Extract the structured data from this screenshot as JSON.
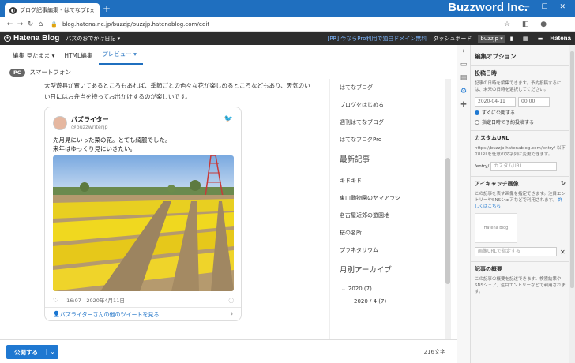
{
  "browser": {
    "tab_title": "ブログ記事編集 - はてなブログ",
    "tab_close": "×",
    "new_tab": "+",
    "brand": "Buzzword Inc.",
    "window_controls": "— ☐ ✕",
    "url": "blog.hatena.ne.jp/buzzjp/buzzjp.hatenablog.com/edit"
  },
  "header": {
    "logo": "Hatena Blog",
    "blog_name": "バズのおでかけ日記",
    "pro_promo": "[PR] 今ならPro利用で独自ドメイン無料",
    "dashboard": "ダッシュボード",
    "user": "buzzjp",
    "hatena": "Hatena"
  },
  "editor": {
    "tabs": [
      {
        "label": "編集"
      },
      {
        "label": "見たまま"
      },
      {
        "label": "HTML編集"
      },
      {
        "label": "プレビュー"
      }
    ],
    "mode_badge": "PC",
    "mode_label": "スマートフォン"
  },
  "preview": {
    "intro_text": "大型遊具が置いてあるところもあれば、季節ごとの色々な花が楽しめるところなどもあり、天気のいい日にはお弁当を持ってお出かけするのが楽しいです。",
    "tweet": {
      "name": "バズライター",
      "handle": "@buzzwriterjp",
      "line1": "先月見にいった菜の花。とても綺麗でした。",
      "line2": "来年はゆっくり見にいきたい。",
      "timestamp": "16:07 - 2020年4月11日",
      "more_link": "バズライターさんの他のツイートを見る"
    },
    "sidebar": {
      "links": [
        "はてなブログ",
        "ブログをはじめる",
        "週刊はてなブログ",
        "はてなブログPro"
      ],
      "recent_title": "最新記事",
      "recent": [
        "キドキド",
        "東山動物園のヤマアラシ",
        "名古屋近郊の遊園地",
        "桜の名所",
        "プラネタリウム"
      ],
      "archive_title": "月別アーカイブ",
      "archive": [
        "2020 (7)",
        "2020 / 4 (7)"
      ]
    }
  },
  "bottom": {
    "publish": "公開する",
    "char_count": "216文字"
  },
  "options": {
    "title": "編集オプション",
    "post_date": {
      "heading": "投稿日時",
      "desc": "記事の日時を編集できます。予約投稿するには、未来の日時を選択してください。",
      "date": "2020-04-11",
      "time": "00:00",
      "radio_now": "すぐに公開する",
      "radio_sched": "指定日時で予約投稿する"
    },
    "custom_url": {
      "heading": "カスタムURL",
      "desc": "https://buzzjp.hatenablog.com/entry/ 以下のURLを任意の文字列に変更できます。",
      "prefix": "/entry/",
      "placeholder": "カスタムURL"
    },
    "eyecatch": {
      "heading": "アイキャッチ画像",
      "desc": "この記事を表す画像を指定できます。注目エントリーやSNSシェアなどで利用されます。",
      "link": "詳しくはこちら",
      "thumb_label": "Hatena Blog",
      "url_placeholder": "画像URLで指定する"
    },
    "summary": {
      "heading": "記事の概要",
      "desc": "この記事の概要を記述できます。検索結果やSNSシェア、注目エントリーなどで利用されます。"
    }
  }
}
